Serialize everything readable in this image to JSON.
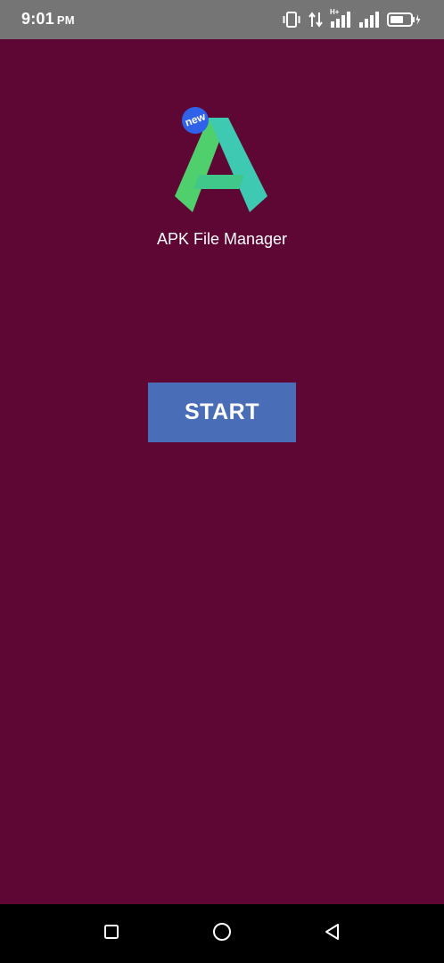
{
  "status_bar": {
    "time": "9:01",
    "ampm": "PM",
    "network_label": "H+",
    "icons": [
      "vibrate-icon",
      "data-transfer-icon",
      "signal-h-plus-icon",
      "signal-icon",
      "battery-charging-icon"
    ]
  },
  "app": {
    "logo_badge": "new",
    "title": "APK File Manager"
  },
  "main": {
    "start_label": "START"
  },
  "nav_bar": {
    "icons": [
      "recents-icon",
      "home-icon",
      "back-icon"
    ]
  },
  "colors": {
    "background": "#5e0735",
    "button": "#4a6db8",
    "status_bar": "#757575",
    "logo_green": "#4fd06d",
    "logo_teal": "#3ec9b3",
    "badge_blue": "#2f62e8"
  }
}
